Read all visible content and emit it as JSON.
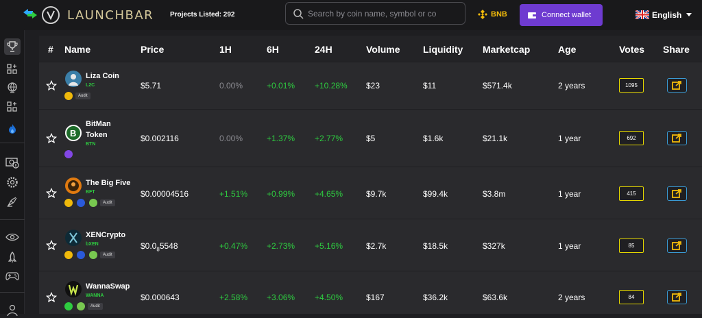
{
  "header": {
    "brand": "LAUNCHBAR",
    "projects_listed": "Projects Listed: 292",
    "search_placeholder": "Search by coin name, symbol or co",
    "chain": "BNB",
    "connect_label": "Connect wallet",
    "language": "English"
  },
  "sidebar": {
    "icons": [
      "trophy-icon",
      "grid-plus-icon",
      "globe-icon",
      "grid-plus-icon",
      "fire-icon",
      "money-icon",
      "gear-icon",
      "satellite-icon",
      "eye-icon",
      "rocket-icon",
      "gamepad-icon",
      "user-icon"
    ]
  },
  "table": {
    "columns": [
      "#",
      "Name",
      "Price",
      "1H",
      "6H",
      "24H",
      "Volume",
      "Liquidity",
      "Marketcap",
      "Age",
      "Votes",
      "Share"
    ],
    "rows": [
      {
        "name": "Liza Coin",
        "symbol": "L2C",
        "price": "$5.71",
        "h1": "0.00%",
        "h6": "+0.01%",
        "h24": "+10.28%",
        "volume": "$23",
        "liquidity": "$11",
        "marketcap": "$571.4k",
        "age": "2 years",
        "votes": "1095",
        "audit": "Audit"
      },
      {
        "name": "BitMan Token",
        "name_line1": "BitMan",
        "name_line2": "Token",
        "symbol": "BTN",
        "price": "$0.002116",
        "h1": "0.00%",
        "h6": "+1.37%",
        "h24": "+2.77%",
        "volume": "$5",
        "liquidity": "$1.6k",
        "marketcap": "$21.1k",
        "age": "1 year",
        "votes": "692"
      },
      {
        "name": "The Big Five",
        "symbol": "BFT",
        "price": "$0.00004516",
        "h1": "+1.51%",
        "h6": "+0.99%",
        "h24": "+4.65%",
        "volume": "$9.7k",
        "liquidity": "$99.4k",
        "marketcap": "$3.8m",
        "age": "1 year",
        "votes": "415",
        "audit": "Audit"
      },
      {
        "name": "XENCrypto",
        "symbol": "bXEN",
        "price_prefix": "$0.0",
        "price_sub": "8",
        "price_suffix": "5548",
        "h1": "+0.47%",
        "h6": "+2.73%",
        "h24": "+5.16%",
        "volume": "$2.7k",
        "liquidity": "$18.5k",
        "marketcap": "$327k",
        "age": "1 year",
        "votes": "85",
        "audit": "Audit"
      },
      {
        "name": "WannaSwap",
        "symbol": "WANNA",
        "price": "$0.000643",
        "h1": "+2.58%",
        "h6": "+3.06%",
        "h24": "+4.50%",
        "volume": "$167",
        "liquidity": "$36.2k",
        "marketcap": "$63.6k",
        "age": "2 years",
        "votes": "84",
        "audit": "Audit"
      }
    ]
  },
  "colors": {
    "accent": "#6e3bd0",
    "positive": "#2ecc40",
    "votes_border": "#e6d800",
    "share_border": "#3a9bd5",
    "share_icon": "#f0b90b",
    "bnb": "#f0b90b"
  }
}
